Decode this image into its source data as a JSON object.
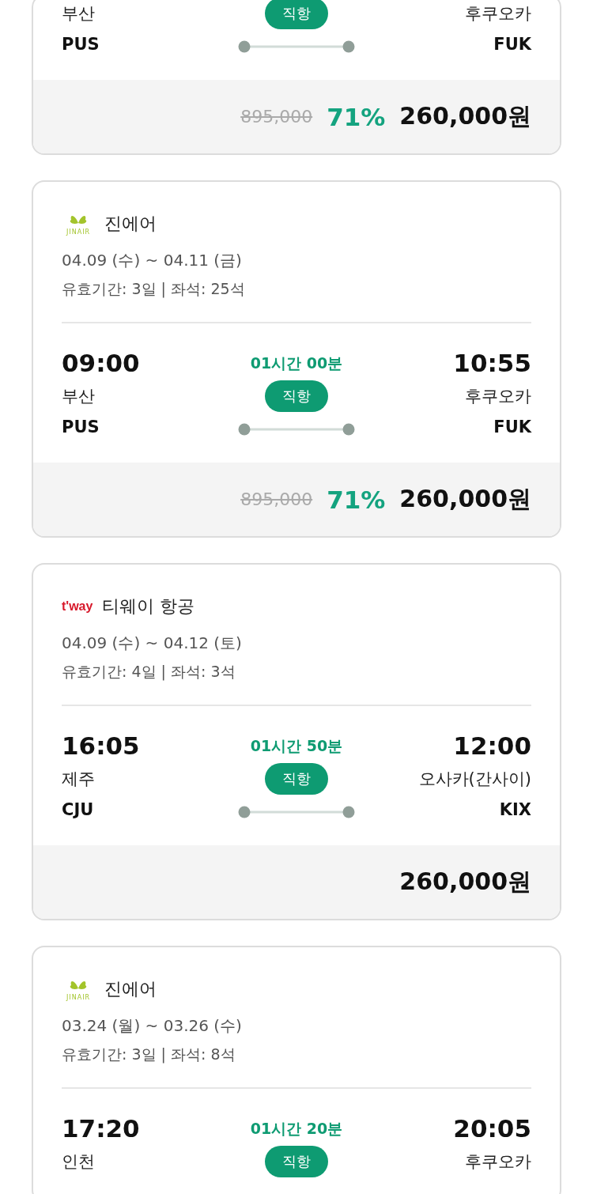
{
  "flights": [
    {
      "departure": {
        "city": "부산",
        "code": "PUS"
      },
      "arrival": {
        "city": "후쿠오카",
        "code": "FUK"
      },
      "badge": "직항",
      "price": {
        "original": "895,000",
        "discount": "71%",
        "final": "260,000원"
      }
    },
    {
      "airline": {
        "kind": "jinair",
        "logo_text": "JINAIR",
        "name": "진에어"
      },
      "dates": "04.09 (수) ~ 04.11 (금)",
      "info": "유효기간: 3일 | 좌석: 25석",
      "departure": {
        "time": "09:00",
        "city": "부산",
        "code": "PUS"
      },
      "duration": "01시간 00분",
      "badge": "직항",
      "arrival": {
        "time": "10:55",
        "city": "후쿠오카",
        "code": "FUK"
      },
      "price": {
        "original": "895,000",
        "discount": "71%",
        "final": "260,000원"
      }
    },
    {
      "airline": {
        "kind": "tway",
        "logo_text": "t'way",
        "name": "티웨이 항공"
      },
      "dates": "04.09 (수) ~ 04.12 (토)",
      "info": "유효기간: 4일 | 좌석: 3석",
      "departure": {
        "time": "16:05",
        "city": "제주",
        "code": "CJU"
      },
      "duration": "01시간 50분",
      "badge": "직항",
      "arrival": {
        "time": "12:00",
        "city": "오사카(간사이)",
        "code": "KIX"
      },
      "price": {
        "final": "260,000원"
      }
    },
    {
      "airline": {
        "kind": "jinair",
        "logo_text": "JINAIR",
        "name": "진에어"
      },
      "dates": "03.24 (월) ~ 03.26 (수)",
      "info": "유효기간: 3일 | 좌석: 8석",
      "departure": {
        "time": "17:20",
        "city": "인천"
      },
      "duration": "01시간 20분",
      "badge": "직항",
      "arrival": {
        "time": "20:05",
        "city": "후쿠오카"
      }
    }
  ]
}
